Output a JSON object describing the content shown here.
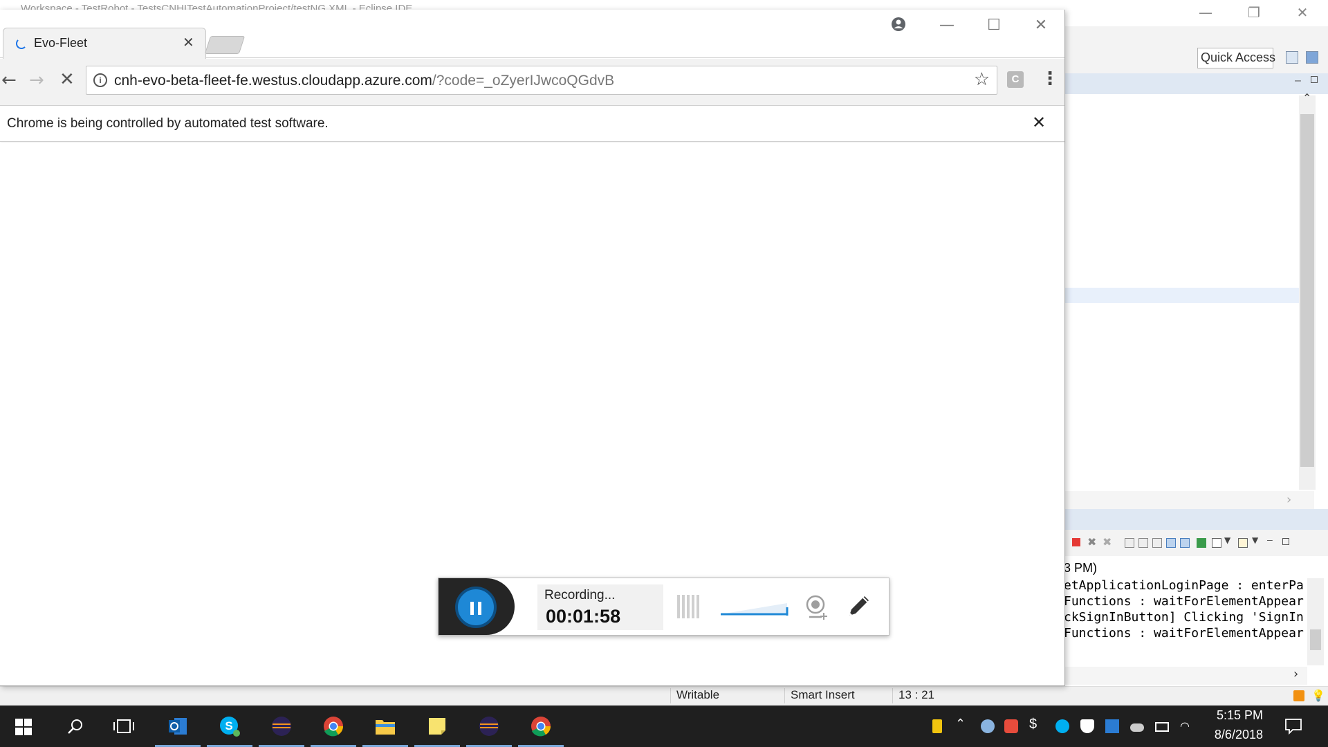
{
  "eclipse": {
    "title": "Workspace - TestRobot - TestsCNHITestAutomationProject/testNG.XML - Eclipse IDE",
    "quick_access": "Quick Access",
    "console": {
      "time_fragment": "3 PM)",
      "lines": [
        "etApplicationLoginPage : enterPa",
        "Functions : waitForElementAppear",
        "ckSignInButton] Clicking 'SignIn",
        "Functions : waitForElementAppear"
      ]
    },
    "status": {
      "writable": "Writable",
      "insert_mode": "Smart Insert",
      "cursor_pos": "13 : 21"
    }
  },
  "chrome": {
    "tab_title": "Evo-Fleet",
    "url_host": "cnh-evo-beta-fleet-fe.westus.cloudapp.azure.com",
    "url_path": "/?code=_oZyerIJwcoQGdvB",
    "extension_letter": "C",
    "infobar_text": "Chrome is being controlled by automated test software."
  },
  "recorder": {
    "label": "Recording...",
    "time": "00:01:58",
    "accent": "#1e88d6"
  },
  "taskbar": {
    "apps": [
      "outlook-icon",
      "skype-icon",
      "eclipse-icon",
      "chrome-icon",
      "file-explorer-icon",
      "sticky-notes-icon",
      "eclipse-icon",
      "chrome-icon"
    ],
    "clock_time": "5:15 PM",
    "clock_date": "8/6/2018"
  }
}
